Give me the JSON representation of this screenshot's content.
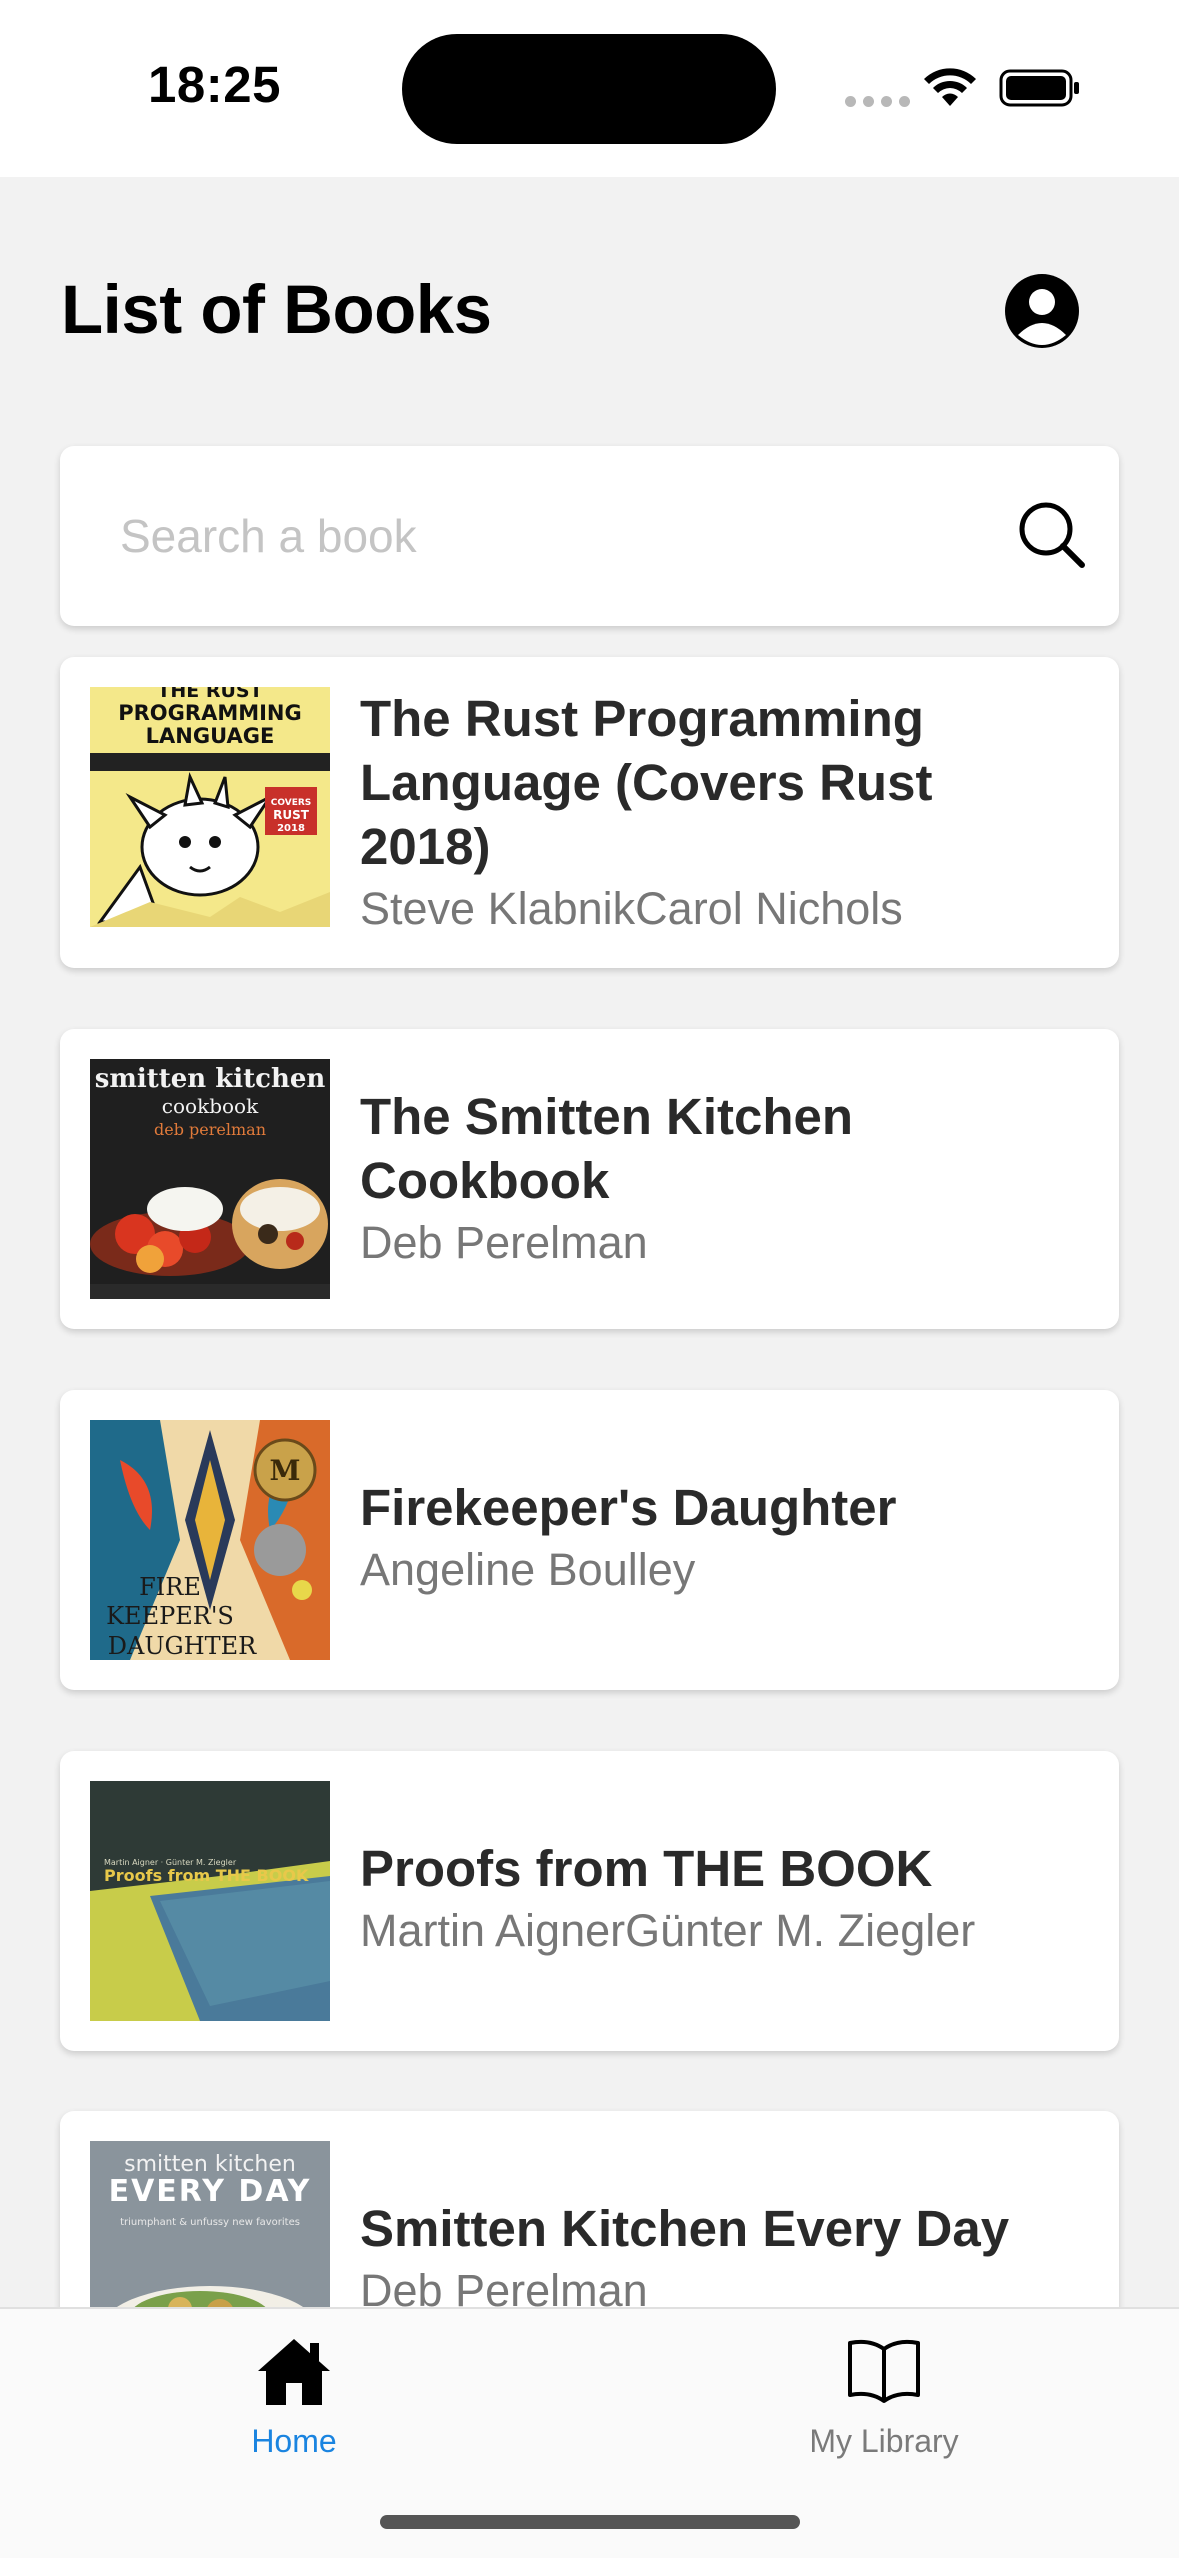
{
  "status_bar": {
    "time": "18:25"
  },
  "header": {
    "title": "List of Books",
    "profile_icon": "user-circle-icon"
  },
  "search": {
    "placeholder": "Search a book",
    "value": "",
    "icon": "search-icon"
  },
  "books": [
    {
      "title_lines": [
        "The Rust Programming",
        "Language (Covers Rust",
        "2018)"
      ],
      "author": "Steve KlabnikCarol Nichols",
      "cover": {
        "line1": "THE RUST",
        "line2": "PROGRAMMING",
        "line3": "LANGUAGE",
        "badge": "COVERS RUST 2018",
        "bg": "#f4e88a"
      }
    },
    {
      "title_lines": [
        "The Smitten Kitchen",
        "Cookbook"
      ],
      "author": "Deb Perelman",
      "cover": {
        "line1": "smitten kitchen",
        "line2": "cookbook",
        "line3": "deb perelman",
        "bg": "#1f1f1f"
      }
    },
    {
      "title_lines": [
        "Firekeeper's Daughter"
      ],
      "author": "Angeline Boulley",
      "cover": {
        "line1": "FIRE",
        "line2": "KEEPER'S",
        "line3": "DAUGHTER",
        "bg": "#f0d9a8"
      }
    },
    {
      "title_lines": [
        "Proofs from THE BOOK"
      ],
      "author": "Martin AignerGünter M. Ziegler",
      "cover": {
        "line1": "Martin Aigner · Günter M. Ziegler",
        "line2": "Proofs from THE BOOK",
        "bg": "#2e3a36"
      }
    },
    {
      "title_lines": [
        "Smitten Kitchen Every Day"
      ],
      "author": "Deb Perelman",
      "cover": {
        "line1": "smitten kitchen",
        "line2": "EVERY DAY",
        "line3": "triumphant & unfussy new favorites",
        "bg": "#8a949c"
      }
    }
  ],
  "tabs": [
    {
      "label": "Home",
      "icon": "home-icon",
      "active": true
    },
    {
      "label": "My Library",
      "icon": "open-book-icon",
      "active": false
    }
  ],
  "colors": {
    "accent": "#1a84e0",
    "background": "#f2f2f2"
  }
}
